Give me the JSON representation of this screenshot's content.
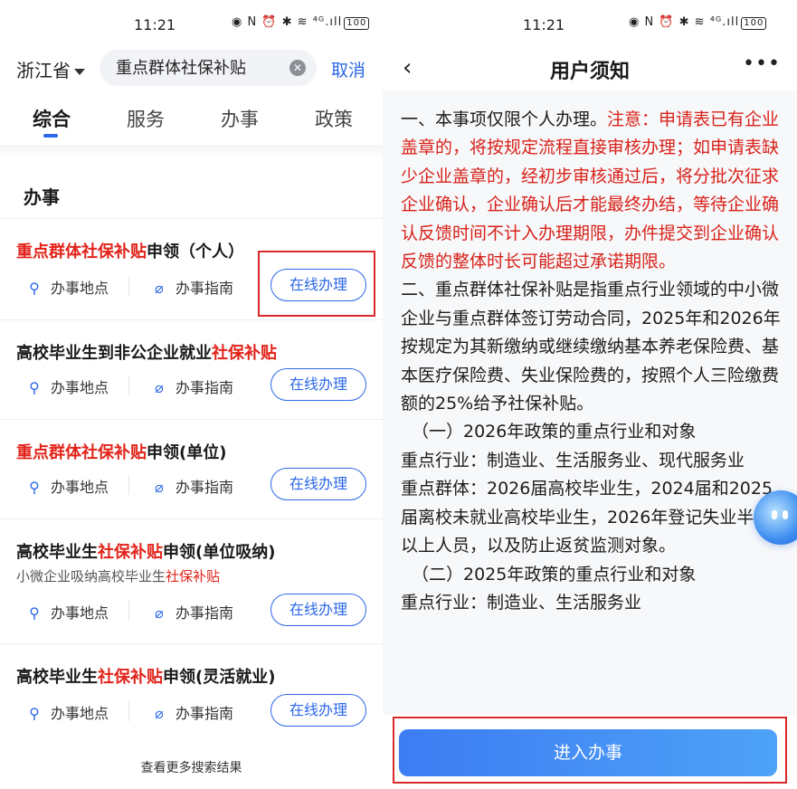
{
  "left": {
    "status": {
      "time": "11:21",
      "icons": "◉ N ⏰ ✱ ≋ ⁴ᴳ.ıll",
      "battery": "100"
    },
    "province": "浙江省",
    "search": {
      "value": "重点群体社保补贴",
      "clear_icon": "clear-icon"
    },
    "cancel": "取消",
    "tabs": [
      "综合",
      "服务",
      "办事",
      "政策"
    ],
    "section_title": "办事",
    "items": [
      {
        "title_parts": [
          "重点群体社保补贴",
          "申领（个人）"
        ],
        "highlight": [
          true,
          false
        ],
        "actions": [
          "办事地点",
          "办事指南"
        ],
        "button": "在线办理"
      },
      {
        "title_parts": [
          "高校毕业生到非公企业就业",
          "社保补贴"
        ],
        "highlight": [
          false,
          true
        ],
        "actions": [
          "办事地点",
          "办事指南"
        ],
        "button": "在线办理"
      },
      {
        "title_parts": [
          "重点群体社保补贴",
          "申领(单位)"
        ],
        "highlight": [
          true,
          false
        ],
        "actions": [
          "办事地点",
          "办事指南"
        ],
        "button": "在线办理"
      },
      {
        "title_parts": [
          "高校毕业生",
          "社保补贴",
          "申领(单位吸纳)"
        ],
        "highlight": [
          false,
          true,
          false
        ],
        "subtitle_parts": [
          "小微企业吸纳高校毕业生",
          "社保补贴"
        ],
        "actions": [
          "办事地点",
          "办事指南"
        ],
        "button": "在线办理"
      },
      {
        "title_parts": [
          "高校毕业生",
          "社保补贴",
          "申领(灵活就业)"
        ],
        "highlight": [
          false,
          true,
          false
        ],
        "actions": [
          "办事地点",
          "办事指南"
        ],
        "button": "在线办理"
      }
    ],
    "more_results": "查看更多搜索结果"
  },
  "right": {
    "status": {
      "time": "11:21",
      "icons": "◉ N ⏰ ✱ ≋ ⁴ᴳ.ıll",
      "battery": "100"
    },
    "back_icon": "chevron-left-icon",
    "title": "用户须知",
    "more_icon": "more-icon",
    "notice": {
      "p1_black": "一、本事项仅限个人办理。",
      "p1_red": "注意：申请表已有企业盖章的，将按规定流程直接审核办理；如申请表缺少企业盖章的，经初步审核通过后，将分批次征求企业确认，企业确认后才能最终办结，等待企业确认反馈时间不计入办理期限，办件提交到企业确认反馈的整体时长可能超过承诺期限。",
      "p2": "二、重点群体社保补贴是指重点行业领域的中小微企业与重点群体签订劳动合同，2025年和2026年按规定为其新缴纳或继续缴纳基本养老保险费、基本医疗保险费、失业保险费的，按照个人三险缴费额的25%给予社保补贴。",
      "p3": "（一）2026年政策的重点行业和对象",
      "p4": "重点行业：制造业、生活服务业、现代服务业",
      "p5": "重点群体：2026届高校毕业生，2024届和2025届离校未就业高校毕业生，2026年登记失业半年以上人员，以及防止返贫监测对象。",
      "p6": "（二）2025年政策的重点行业和对象",
      "p7": "重点行业：制造业、生活服务业"
    },
    "enter_button": "进入办事"
  }
}
